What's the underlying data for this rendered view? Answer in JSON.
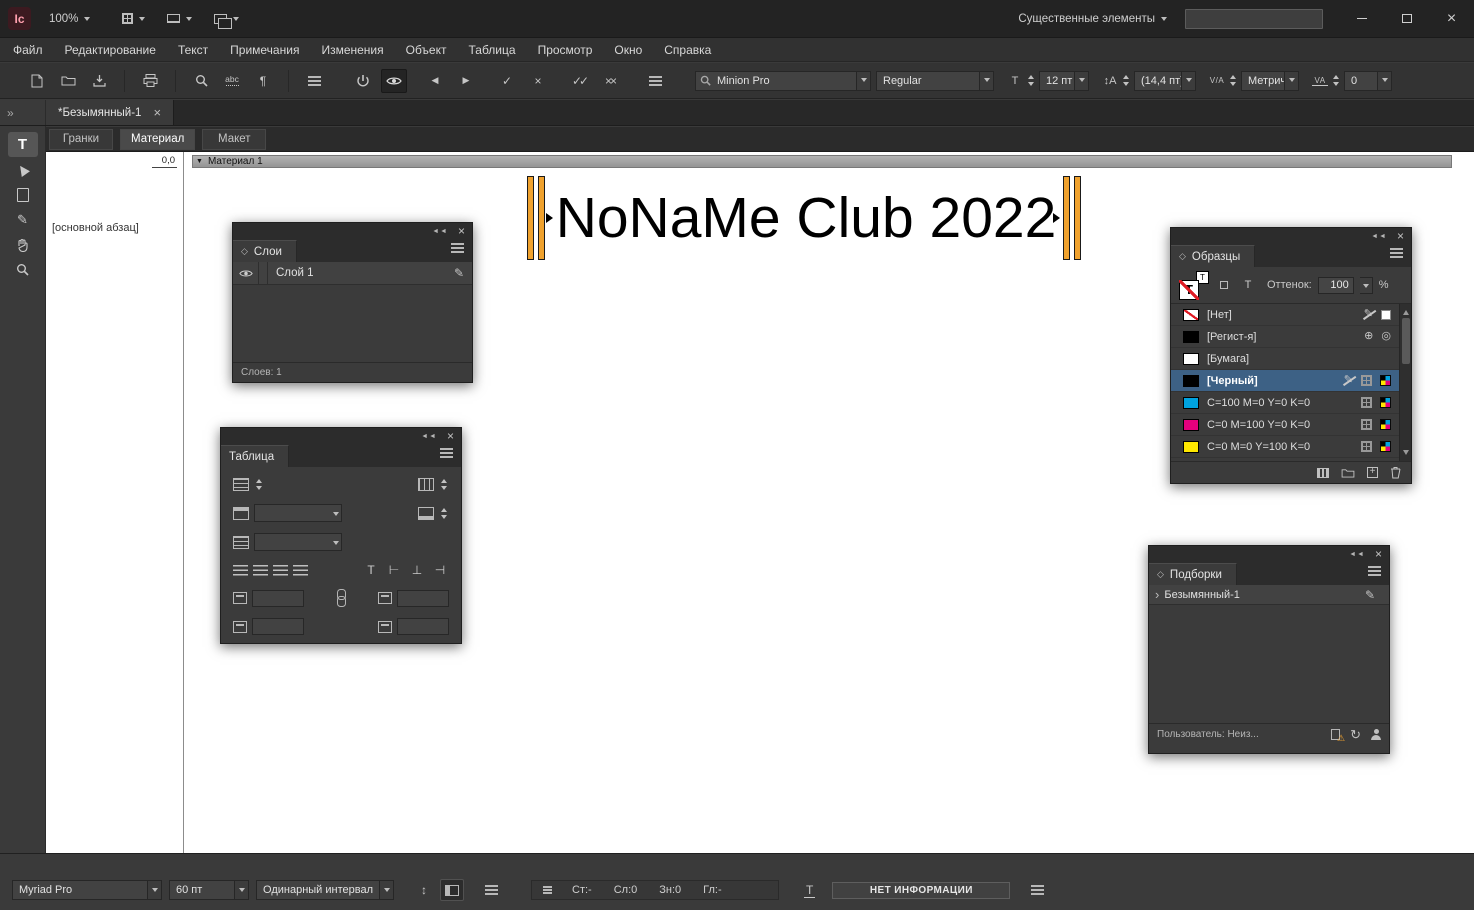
{
  "titlebar": {
    "app_icon": "Ic",
    "zoom_value": "100%",
    "workspace_label": "Существенные элементы"
  },
  "menubar": {
    "items": [
      "Файл",
      "Редактирование",
      "Текст",
      "Примечания",
      "Изменения",
      "Объект",
      "Таблица",
      "Просмотр",
      "Окно",
      "Справка"
    ]
  },
  "toolbar": {
    "font_family": "Minion Pro",
    "font_style": "Regular",
    "font_size": "12 пт",
    "leading": "(14,4 пт)",
    "kerning": "Метрич.",
    "tracking": "0"
  },
  "document": {
    "tab_title": "*Безымянный-1",
    "view_tabs": [
      "Гранки",
      "Материал",
      "Макет"
    ],
    "active_view_index": 1,
    "story_bar_title": "Материал 1",
    "story_text": "NoNaMe Club 2022",
    "paragraph_style": "[основной абзац]",
    "ruler_origin": "0,0"
  },
  "panels": {
    "layers": {
      "title": "Слои",
      "layer_name": "Слой 1",
      "status": "Слоев: 1"
    },
    "table": {
      "title": "Таблица"
    },
    "swatches": {
      "title": "Образцы",
      "tint_label": "Оттенок:",
      "tint_value": "100",
      "percent": "%",
      "rows": [
        {
          "name": "[Нет]",
          "swatch": "none",
          "icons": [
            "noneditable",
            "paper"
          ]
        },
        {
          "name": "[Регист-я]",
          "swatch": "#000000",
          "icons": [
            "registration-cross",
            "registration-target"
          ]
        },
        {
          "name": "[Бумага]",
          "swatch": "#ffffff",
          "icons": []
        },
        {
          "name": "[Черный]",
          "swatch": "#000000",
          "selected": true,
          "icons": [
            "noneditable",
            "grid",
            "cmyk"
          ]
        },
        {
          "name": "C=100 M=0 Y=0 K=0",
          "swatch": "#00a3e0",
          "icons": [
            "grid",
            "cmyk"
          ]
        },
        {
          "name": "C=0 M=100 Y=0 K=0",
          "swatch": "#e5007d",
          "icons": [
            "grid",
            "cmyk"
          ]
        },
        {
          "name": "C=0 M=0 Y=100 K=0",
          "swatch": "#ffe800",
          "icons": [
            "grid",
            "cmyk"
          ]
        }
      ]
    },
    "assignments": {
      "title": "Подборки",
      "item": "Безымянный-1",
      "status": "Пользователь: Неиз..."
    }
  },
  "statusbar": {
    "font_family": "Myriad Pro",
    "font_size": "60 пт",
    "leading_mode": "Одинарный интервал",
    "stats": [
      "Ст:-",
      "Сл:0",
      "Зн:0",
      "Гл:-"
    ],
    "info": "НЕТ ИНФОРМАЦИИ"
  },
  "colors": {
    "accent_orange": "#f0a22e",
    "selection_blue": "#3d6185",
    "cyan": "#00a3e0",
    "magenta": "#e5007d",
    "yellow": "#ffe800"
  }
}
